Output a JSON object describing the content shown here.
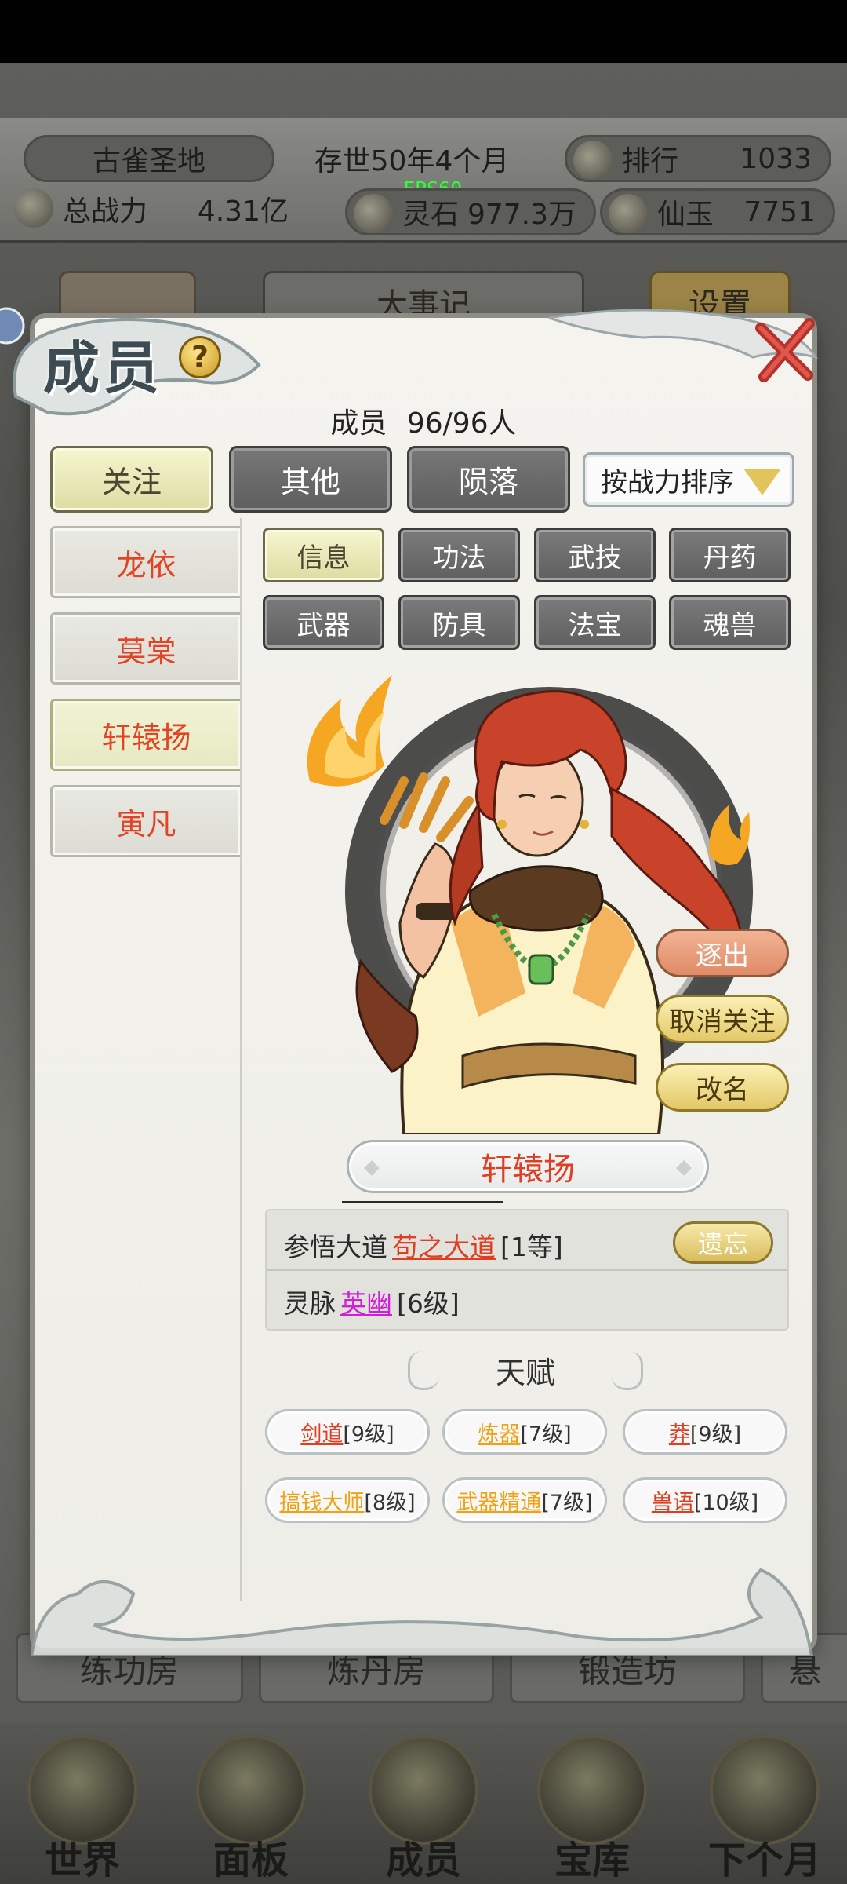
{
  "hud": {
    "sect_name": "古雀圣地",
    "age": "存世50年4个月",
    "rank_label": "排行",
    "rank_value": "1033",
    "power_label": "总战力",
    "power_value": "4.31亿",
    "fps": "FPS60",
    "spirit_stone_label": "灵石",
    "spirit_stone_value": "977.3万",
    "jade_label": "仙玉",
    "jade_value": "7751"
  },
  "background": {
    "tab_center": "大事记",
    "tab_right": "设置",
    "rooms": [
      "练功房",
      "炼丹房",
      "锻造坊",
      "悬"
    ]
  },
  "bottom_nav": [
    "世界",
    "面板",
    "成员",
    "宝库",
    "下个月"
  ],
  "dialog": {
    "title": "成员",
    "help": "?",
    "count_label": "成员",
    "count_value": "96/96人",
    "filters": [
      "关注",
      "其他",
      "陨落"
    ],
    "sort_label": "按战力排序",
    "members": [
      "龙依",
      "莫棠",
      "轩辕扬",
      "寅凡"
    ],
    "sub_tabs": [
      "信息",
      "功法",
      "武技",
      "丹药",
      "武器",
      "防具",
      "法宝",
      "魂兽"
    ],
    "actions": {
      "expel": "逐出",
      "unfollow": "取消关注",
      "rename": "改名"
    },
    "selected_name": "轩辕扬",
    "dao": {
      "label": "参悟大道",
      "name": "苟之大道",
      "grade": "[1等]",
      "forget": "遗忘"
    },
    "vein": {
      "label": "灵脉",
      "name": "英幽",
      "level": "[6级]"
    },
    "talent_title": "天赋",
    "talents": [
      {
        "name": "剑道",
        "level": "[9级]",
        "color": "#e03e22"
      },
      {
        "name": "炼器",
        "level": "[7级]",
        "color": "#f2a114"
      },
      {
        "name": "莽",
        "level": "[9级]",
        "color": "#e03e22"
      },
      {
        "name": "搞钱大师",
        "level": "[8级]",
        "color": "#f2a114"
      },
      {
        "name": "武器精通",
        "level": "[7级]",
        "color": "#f2a114"
      },
      {
        "name": "兽语",
        "level": "[10级]",
        "color": "#e03e22"
      }
    ]
  }
}
